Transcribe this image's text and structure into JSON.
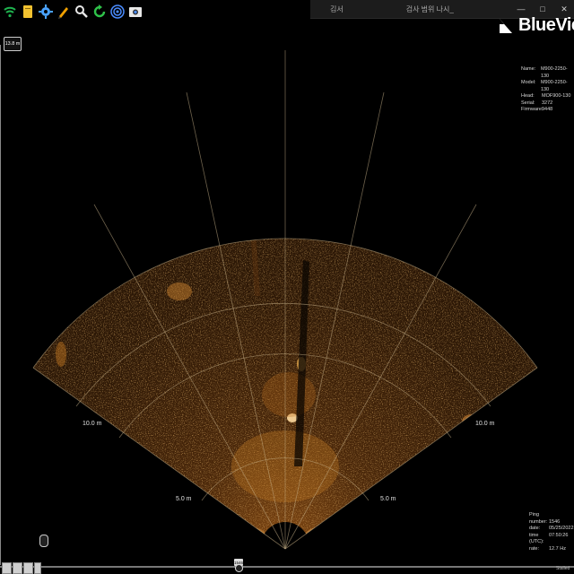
{
  "toolbar": {
    "buttons": [
      {
        "name": "wifi-icon",
        "color": "#1fb34f"
      },
      {
        "name": "document-icon",
        "color": "#f2c230"
      },
      {
        "name": "settings-icon",
        "color": "#4aa3ff"
      },
      {
        "name": "pencil-icon",
        "color": "#f0a000"
      },
      {
        "name": "search-icon",
        "color": "#e8e8e8"
      },
      {
        "name": "refresh-icon",
        "color": "#2fc24a"
      },
      {
        "name": "target-icon",
        "color": "#4a8cff"
      },
      {
        "name": "camera-icon",
        "color": "#e8e8e8"
      }
    ]
  },
  "notification": {
    "title": "김서",
    "subtitle": "검사 범위 나시_",
    "minimize": "—",
    "restore": "□",
    "close": "✕"
  },
  "brand": {
    "name": "BlueView"
  },
  "sonar_info": {
    "rows": [
      {
        "label": "Name:",
        "value": "M900-2250-130"
      },
      {
        "label": "Model:",
        "value": "M900-2250-130"
      },
      {
        "label": "Head:",
        "value": "MOF900-130"
      },
      {
        "label": "Serial:",
        "value": "3272"
      },
      {
        "label": "Firmware:",
        "value": "9448"
      }
    ]
  },
  "range_top_label": "13.8 m",
  "range_labels": {
    "left_10": "10.0 m",
    "right_10": "10.0 m",
    "left_5": "5.0 m",
    "right_5": "5.0 m"
  },
  "ping_info": {
    "header": "Ping",
    "rows": [
      {
        "label": "number:",
        "value": "1546"
      },
      {
        "label": "date:",
        "value": "05/25/2022"
      },
      {
        "label": "time (UTC):",
        "value": "07:50:26"
      },
      {
        "label": "rate:",
        "value": "12.7 Hz"
      }
    ]
  },
  "timeline": {
    "marker": "1546",
    "footer": "Stalled"
  },
  "colors": {
    "sonar_accent": "#d9822b",
    "background": "#000000"
  }
}
